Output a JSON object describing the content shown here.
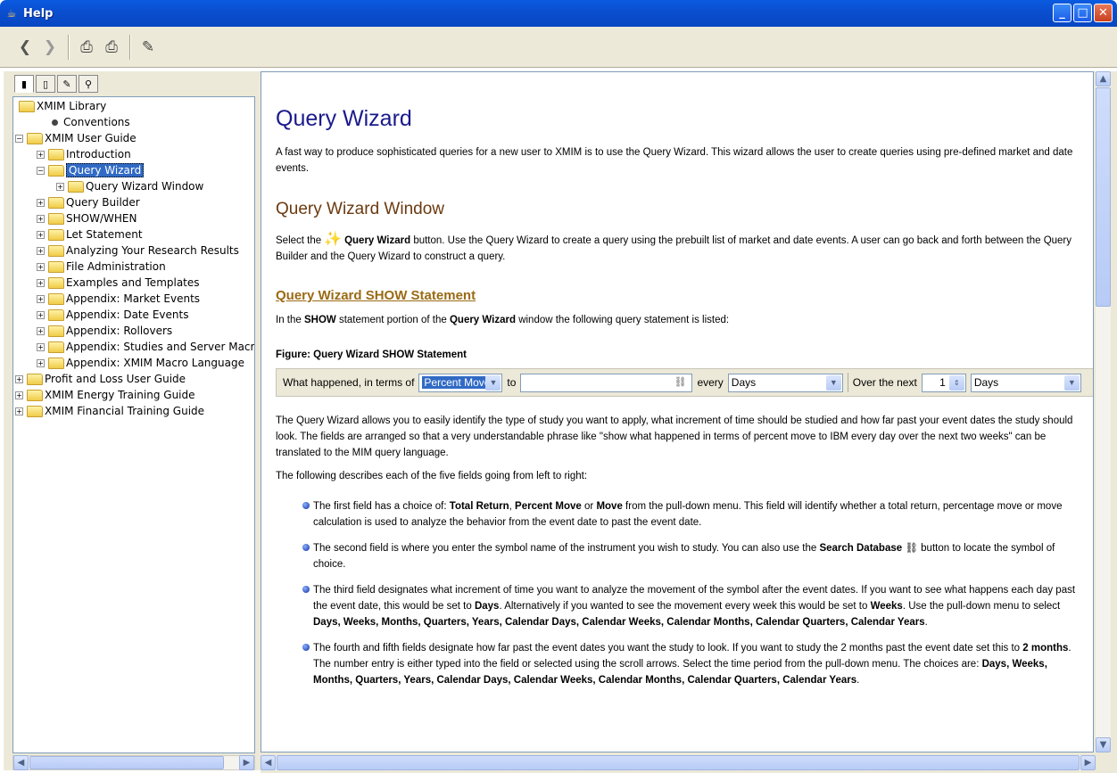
{
  "window": {
    "title": "Help"
  },
  "toolbar": {
    "buttons": [
      {
        "icon": "back-arrow-icon",
        "glyph": "❮"
      },
      {
        "icon": "forward-arrow-icon",
        "glyph": "❯"
      },
      {
        "icon": "print-icon",
        "glyph": "🖶"
      },
      {
        "icon": "page-setup-icon",
        "glyph": "🖶"
      },
      {
        "icon": "merge-icon",
        "glyph": "⛟"
      }
    ]
  },
  "nav_tabs": [
    {
      "name": "tab-contents",
      "glyph": "▮"
    },
    {
      "name": "tab-index",
      "glyph": "▯"
    },
    {
      "name": "tab-glossary",
      "glyph": "✎"
    },
    {
      "name": "tab-search",
      "glyph": "⚲"
    }
  ],
  "tree": [
    {
      "label": "XMIM Library",
      "level": 0,
      "kind": "folder-open",
      "exp": ""
    },
    {
      "label": "Conventions",
      "level": 1,
      "kind": "doc",
      "exp": ""
    },
    {
      "label": "XMIM User Guide",
      "level": 0,
      "kind": "folder-open",
      "exp": "−"
    },
    {
      "label": "Introduction",
      "level": 1,
      "kind": "folder",
      "exp": "+"
    },
    {
      "label": "Query Wizard",
      "level": 1,
      "kind": "folder-open",
      "exp": "−",
      "selected": true
    },
    {
      "label": "Query Wizard Window",
      "level": 2,
      "kind": "folder",
      "exp": "+"
    },
    {
      "label": "Query Builder",
      "level": 1,
      "kind": "folder",
      "exp": "+"
    },
    {
      "label": "SHOW/WHEN",
      "level": 1,
      "kind": "folder",
      "exp": "+"
    },
    {
      "label": "Let Statement",
      "level": 1,
      "kind": "folder",
      "exp": "+"
    },
    {
      "label": "Analyzing Your Research Results",
      "level": 1,
      "kind": "folder",
      "exp": "+"
    },
    {
      "label": "File Administration",
      "level": 1,
      "kind": "folder",
      "exp": "+"
    },
    {
      "label": "Examples and Templates",
      "level": 1,
      "kind": "folder",
      "exp": "+"
    },
    {
      "label": "Appendix: Market Events",
      "level": 1,
      "kind": "folder",
      "exp": "+"
    },
    {
      "label": "Appendix: Date Events",
      "level": 1,
      "kind": "folder",
      "exp": "+"
    },
    {
      "label": "Appendix: Rollovers",
      "level": 1,
      "kind": "folder",
      "exp": "+"
    },
    {
      "label": "Appendix: Studies and Server Macros",
      "level": 1,
      "kind": "folder",
      "exp": "+"
    },
    {
      "label": "Appendix: XMIM Macro Language",
      "level": 1,
      "kind": "folder",
      "exp": "+"
    },
    {
      "label": "Profit and Loss User Guide",
      "level": 0,
      "kind": "folder",
      "exp": "+"
    },
    {
      "label": "XMIM Energy Training Guide",
      "level": 0,
      "kind": "folder",
      "exp": "+"
    },
    {
      "label": "XMIM Financial Training Guide",
      "level": 0,
      "kind": "folder",
      "exp": "+"
    }
  ],
  "content": {
    "title": "Query Wizard",
    "intro": "A fast way to produce sophisticated queries for a new user to XMIM is to use the Query Wizard. This wizard allows the user to create queries using pre-defined market and date events.",
    "section_title": "Query Wizard Window",
    "select_pre": "Select the",
    "select_bold": "Query Wizard",
    "select_post": "button. Use the Query Wizard to create a query using the prebuilt list of market and date events. A user can go back and forth between the Query Builder and the Query Wizard to construct a query.",
    "show_link": "Query Wizard SHOW Statement",
    "show_intro": [
      "In the ",
      "SHOW",
      " statement portion of the ",
      "Query Wizard",
      " window the following query statement is listed:"
    ],
    "figure_caption": "Figure: Query Wizard SHOW Statement",
    "qw": {
      "label1": "What happened, in terms of",
      "field1": "Percent Move",
      "label2": "to",
      "field2": "",
      "label3": "every",
      "field3": "Days",
      "label4": "Over the next",
      "number": "1",
      "field5": "Days"
    },
    "para1": "The Query Wizard allows you to easily identify the type of study you want to apply, what increment of time should be studied and how far past your event dates the study should look. The fields are arranged so that a very understandable phrase like \"show what happened in terms of percent move to IBM every day over the next two weeks\" can be translated to the MIM query language.",
    "para2": "The following describes each of the five fields going from left to right:",
    "bullets": [
      [
        "The first field has a choice of: ",
        "Total Return",
        ", ",
        "Percent Move",
        " or ",
        "Move",
        " from the pull-down menu. This field will identify whether a total return, percentage move or move calculation is used to analyze the behavior from the event date to past the event date."
      ],
      [
        "The second field is where you enter the symbol name of the instrument you wish to study. You can also use the ",
        "Search Database",
        " ⛓ button to locate the symbol of choice."
      ],
      [
        "The third field designates what increment of time you want to analyze the movement of the symbol after the event dates. If you want to see what happens each day past the event date, this would be set to ",
        "Days",
        ". Alternatively if you wanted to see the movement every week this would be set to ",
        "Weeks",
        ". Use the pull-down menu to select ",
        "Days, Weeks, Months, Quarters, Years, Calendar Days, Calendar Weeks, Calendar Months, Calendar Quarters, Calendar Years",
        "."
      ],
      [
        "The fourth and fifth fields designate how far past the event dates you want the study to look. If you want to study the 2 months past the event date set this to ",
        "2 months",
        ". The number entry is either typed into the field or selected using the scroll arrows. Select the time period from the pull-down menu. The choices are: ",
        "Days, Weeks, Months, Quarters, Years, Calendar Days, Calendar Weeks, Calendar Months, Calendar Quarters, Calendar Years",
        "."
      ]
    ]
  }
}
